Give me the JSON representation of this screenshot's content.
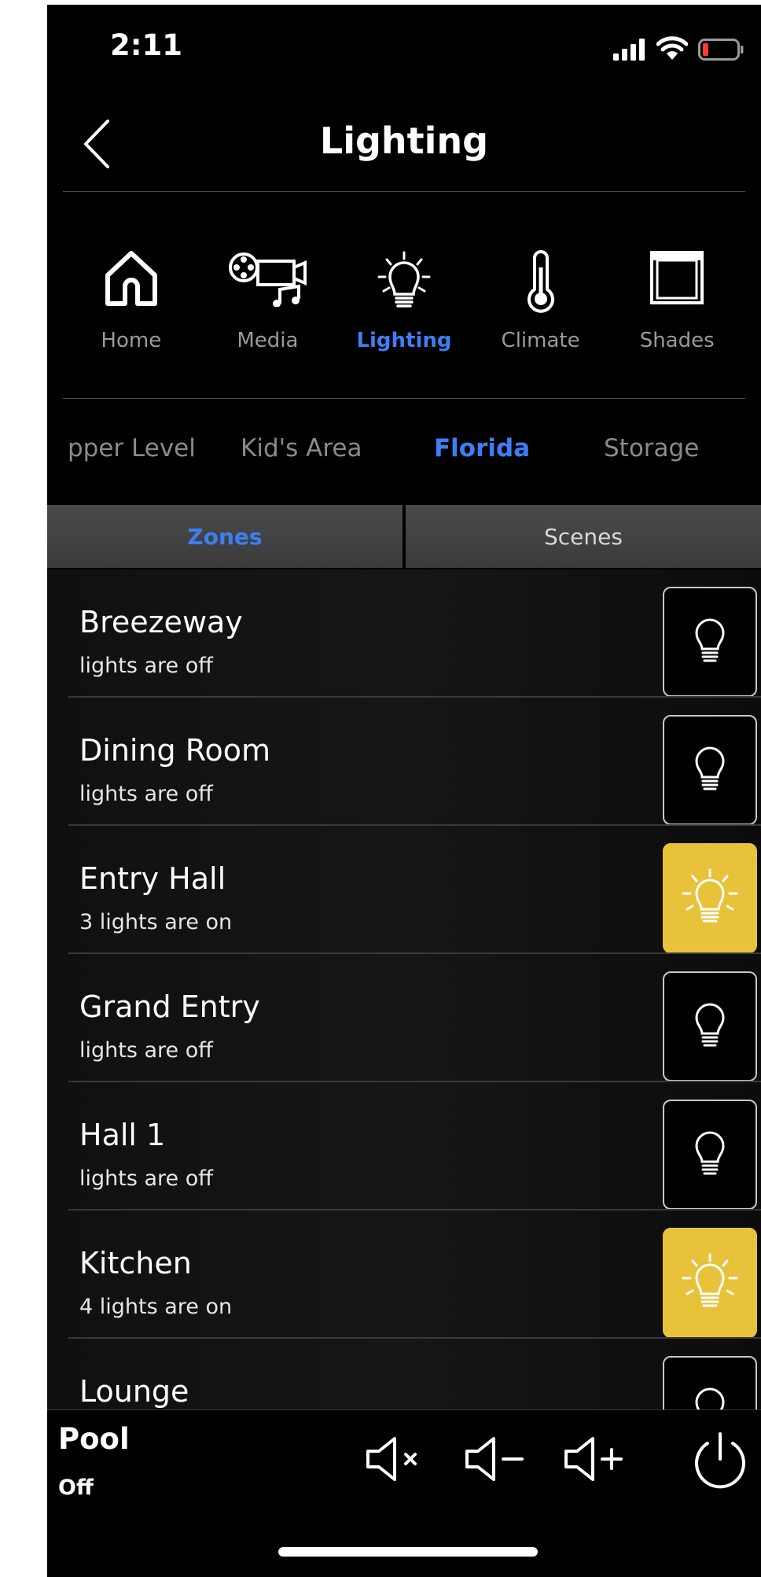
{
  "status_bar": {
    "time": "2:11",
    "icons": [
      "cellular-signal-icon",
      "wifi-icon",
      "battery-low-icon"
    ]
  },
  "header": {
    "title": "Lighting",
    "back_icon": "chevron-left-icon"
  },
  "nav": {
    "items": [
      {
        "label": "Home",
        "icon": "home-icon",
        "active": false
      },
      {
        "label": "Media",
        "icon": "media-icon",
        "active": false
      },
      {
        "label": "Lighting",
        "icon": "lightbulb-icon",
        "active": true
      },
      {
        "label": "Climate",
        "icon": "thermometer-icon",
        "active": false
      },
      {
        "label": "Shades",
        "icon": "shade-icon",
        "active": false
      }
    ]
  },
  "areas": {
    "items": [
      {
        "label": "pper Level",
        "active": false
      },
      {
        "label": "Kid's Area",
        "active": false
      },
      {
        "label": "Florida",
        "active": true
      },
      {
        "label": "Storage",
        "active": false
      }
    ]
  },
  "tabs": {
    "zones": "Zones",
    "scenes": "Scenes",
    "active": "zones"
  },
  "zones": [
    {
      "name": "Breezeway",
      "status": "lights are off",
      "on": false
    },
    {
      "name": "Dining Room",
      "status": "lights are off",
      "on": false
    },
    {
      "name": "Entry Hall",
      "status": "3 lights are on",
      "on": true
    },
    {
      "name": "Grand Entry",
      "status": "lights are off",
      "on": false
    },
    {
      "name": "Hall 1",
      "status": "lights are off",
      "on": false
    },
    {
      "name": "Kitchen",
      "status": "4 lights are on",
      "on": true
    },
    {
      "name": "Lounge",
      "status": "",
      "on": false
    }
  ],
  "now_playing": {
    "title": "Pool",
    "status": "Off"
  },
  "controls": [
    "mute-icon",
    "volume-down-icon",
    "volume-up-icon",
    "power-icon"
  ],
  "colors": {
    "accent": "#3d7ef5",
    "light_on": "#e8c23a",
    "background": "#000000"
  }
}
